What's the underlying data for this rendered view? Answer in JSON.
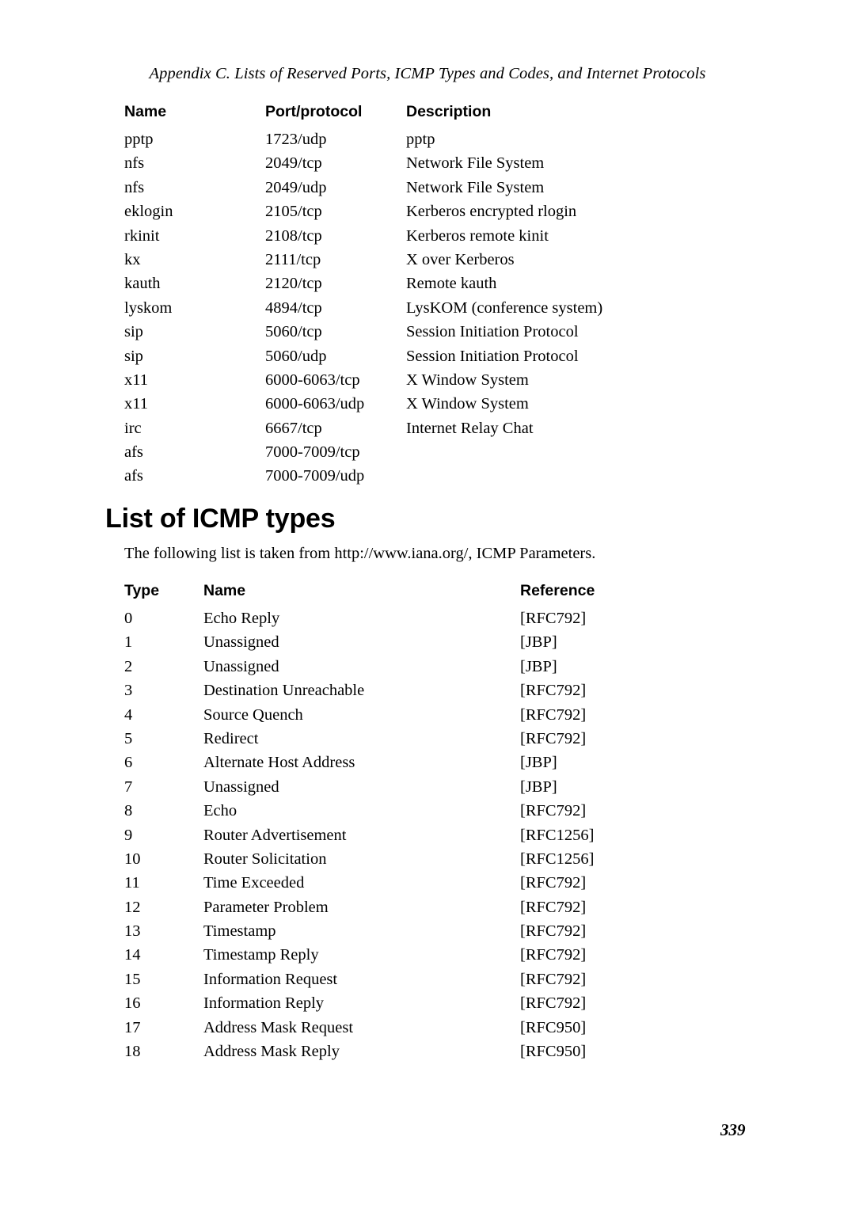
{
  "running_head": "Appendix C. Lists of Reserved Ports, ICMP Types and Codes, and Internet Protocols",
  "ports_table": {
    "headers": {
      "name": "Name",
      "port": "Port/protocol",
      "description": "Description"
    },
    "rows": [
      {
        "name": "pptp",
        "port": "1723/udp",
        "description": "pptp"
      },
      {
        "name": "nfs",
        "port": "2049/tcp",
        "description": "Network File System"
      },
      {
        "name": "nfs",
        "port": "2049/udp",
        "description": "Network File System"
      },
      {
        "name": "eklogin",
        "port": "2105/tcp",
        "description": "Kerberos encrypted rlogin"
      },
      {
        "name": "rkinit",
        "port": "2108/tcp",
        "description": "Kerberos remote kinit"
      },
      {
        "name": "kx",
        "port": "2111/tcp",
        "description": "X over Kerberos"
      },
      {
        "name": "kauth",
        "port": "2120/tcp",
        "description": "Remote kauth"
      },
      {
        "name": "lyskom",
        "port": "4894/tcp",
        "description": "LysKOM (conference system)"
      },
      {
        "name": "sip",
        "port": "5060/tcp",
        "description": "Session Initiation Protocol"
      },
      {
        "name": "sip",
        "port": "5060/udp",
        "description": "Session Initiation Protocol"
      },
      {
        "name": "x11",
        "port": "6000-6063/tcp",
        "description": "X Window System"
      },
      {
        "name": "x11",
        "port": "6000-6063/udp",
        "description": "X Window System"
      },
      {
        "name": "irc",
        "port": "6667/tcp",
        "description": "Internet Relay Chat"
      },
      {
        "name": "afs",
        "port": "7000-7009/tcp",
        "description": ""
      },
      {
        "name": "afs",
        "port": "7000-7009/udp",
        "description": ""
      }
    ]
  },
  "section": {
    "heading": "List of ICMP types",
    "intro": "The following list is taken from http://www.iana.org/, ICMP Parameters."
  },
  "icmp_table": {
    "headers": {
      "type": "Type",
      "name": "Name",
      "reference": "Reference"
    },
    "rows": [
      {
        "type": "0",
        "name": "Echo Reply",
        "reference": "[RFC792]"
      },
      {
        "type": "1",
        "name": "Unassigned",
        "reference": "[JBP]"
      },
      {
        "type": "2",
        "name": "Unassigned",
        "reference": "[JBP]"
      },
      {
        "type": "3",
        "name": "Destination Unreachable",
        "reference": "[RFC792]"
      },
      {
        "type": "4",
        "name": "Source Quench",
        "reference": "[RFC792]"
      },
      {
        "type": "5",
        "name": "Redirect",
        "reference": "[RFC792]"
      },
      {
        "type": "6",
        "name": "Alternate Host Address",
        "reference": "[JBP]"
      },
      {
        "type": "7",
        "name": "Unassigned",
        "reference": "[JBP]"
      },
      {
        "type": "8",
        "name": "Echo",
        "reference": "[RFC792]"
      },
      {
        "type": "9",
        "name": "Router Advertisement",
        "reference": "[RFC1256]"
      },
      {
        "type": "10",
        "name": "Router Solicitation",
        "reference": "[RFC1256]"
      },
      {
        "type": "11",
        "name": "Time Exceeded",
        "reference": "[RFC792]"
      },
      {
        "type": "12",
        "name": "Parameter Problem",
        "reference": "[RFC792]"
      },
      {
        "type": "13",
        "name": "Timestamp",
        "reference": "[RFC792]"
      },
      {
        "type": "14",
        "name": "Timestamp Reply",
        "reference": "[RFC792]"
      },
      {
        "type": "15",
        "name": "Information Request",
        "reference": "[RFC792]"
      },
      {
        "type": "16",
        "name": "Information Reply",
        "reference": "[RFC792]"
      },
      {
        "type": "17",
        "name": "Address Mask Request",
        "reference": "[RFC950]"
      },
      {
        "type": "18",
        "name": "Address Mask Reply",
        "reference": "[RFC950]"
      }
    ]
  },
  "page_number": "339"
}
